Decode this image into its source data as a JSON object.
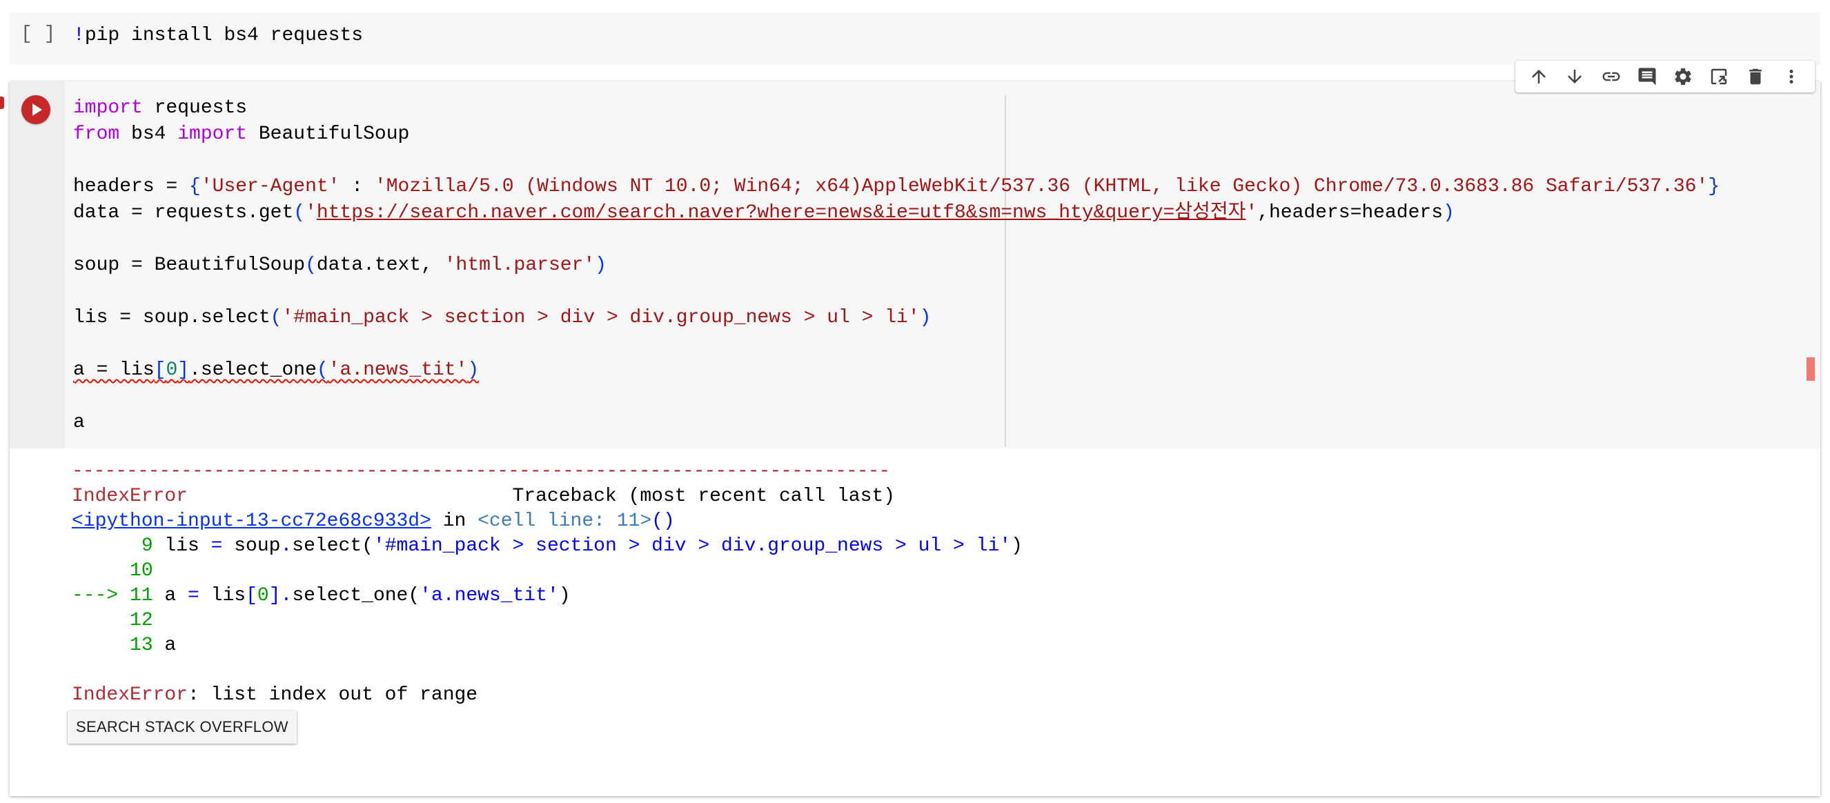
{
  "cell1": {
    "prompt": "[ ]",
    "bang": "!",
    "code": "pip install bs4 requests"
  },
  "cell2": {
    "lines": {
      "l1_kw": "import",
      "l1_rest": " requests",
      "l2_kw1": "from",
      "l2_mid": " bs4 ",
      "l2_kw2": "import",
      "l2_rest": " BeautifulSoup",
      "l4_a": "headers = ",
      "l4_b1": "{",
      "l4_s1": "'User-Agent'",
      "l4_c": " : ",
      "l4_s2": "'Mozilla/5.0 (Windows NT 10.0; Win64; x64)AppleWebKit/537.36 (KHTML, like Gecko) Chrome/73.0.3683.86 Safari/537.36'",
      "l4_b2": "}",
      "l5_a": "data = requests.get",
      "l5_p1": "(",
      "l5_q1": "'",
      "l5_url": "https://search.naver.com/search.naver?where=news&ie=utf8&sm=nws_hty&query=삼성전자",
      "l5_q2": "'",
      "l5_rest": ",headers=headers",
      "l5_p2": ")",
      "l7_a": "soup = BeautifulSoup",
      "l7_p1": "(",
      "l7_mid": "data.text, ",
      "l7_s": "'html.parser'",
      "l7_p2": ")",
      "l9_a": "lis = soup.select",
      "l9_p1": "(",
      "l9_s": "'#main_pack > section > div > div.group_news > ul > li'",
      "l9_p2": ")",
      "l11_a": "a = lis",
      "l11_b1": "[",
      "l11_n": "0",
      "l11_b2": "]",
      "l11_c": ".select_one",
      "l11_p1": "(",
      "l11_s": "'a.news_tit'",
      "l11_p2": ")",
      "l13": "a"
    }
  },
  "output": {
    "dashes": "---------------------------------------------------------------------------",
    "err_name": "IndexError",
    "traceback_hdr": "                            Traceback (most recent call last)",
    "input_link": "<ipython-input-13-cc72e68c933d>",
    "in_word": " in ",
    "cell_ref": "<cell line: 11>",
    "cell_paren": "()",
    "t9_no": "      9",
    "t9_a": " lis ",
    "t9_eq": "=",
    "t9_b": " soup",
    "t9_c": ".",
    "t9_d": "select(",
    "t9_s": "'#main_pack > section > div > div.group_news > ul > li'",
    "t9_e": ")",
    "t10_no": "     10",
    "t11_arrow": "---> 11",
    "t11_a": " a ",
    "t11_eq": "=",
    "t11_b": " lis",
    "t11_c": "[",
    "t11_n": "0",
    "t11_d": "]",
    "t11_e": ".",
    "t11_f": "select_one(",
    "t11_s": "'a.news_tit'",
    "t11_g": ")",
    "t12_no": "     12",
    "t13_no": "     13",
    "t13_a": " a",
    "final_err": "IndexError",
    "final_msg": ": list index out of range"
  },
  "so_button": "SEARCH STACK OVERFLOW",
  "toolbar": [
    "arrow-up-icon",
    "arrow-down-icon",
    "link-icon",
    "comment-icon",
    "gear-icon",
    "mirror-icon",
    "trash-icon",
    "more-vert-icon"
  ]
}
